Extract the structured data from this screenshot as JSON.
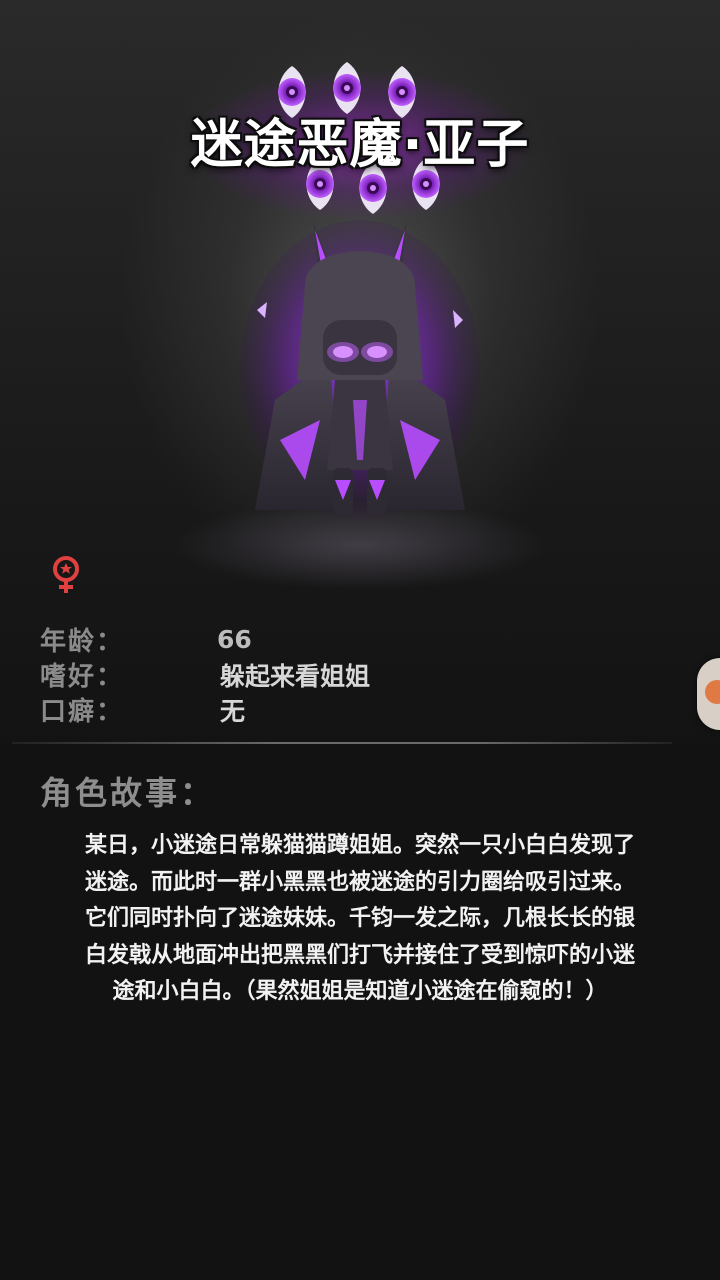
{
  "character": {
    "name": "迷途恶魔·亚子",
    "gender": "female",
    "gender_icon": "female-symbol-icon",
    "eye_badge_count": 6,
    "accent_color": "#b84dff"
  },
  "info": [
    {
      "label": "年龄：",
      "value": "66"
    },
    {
      "label": "嗜好：",
      "value": "躲起来看姐姐"
    },
    {
      "label": "口癖：",
      "value": "无"
    }
  ],
  "story": {
    "heading": "角色故事：",
    "lines": [
      "某日，小迷途日常躲猫猫蹲姐姐。突然一只小白白发现了",
      "迷途。而此时一群小黑黑也被迷途的引力圈给吸引过来。",
      "它们同时扑向了迷途妹妹。千钧一发之际，几根长长的银",
      "白发戟从地面冲出把黑黑们打飞并接住了受到惊吓的小迷",
      "途和小白白。（果然姐姐是知道小迷途在偷窥的！）"
    ]
  },
  "side_button": {
    "icon": "side-menu-icon",
    "color": "#e07a45"
  }
}
